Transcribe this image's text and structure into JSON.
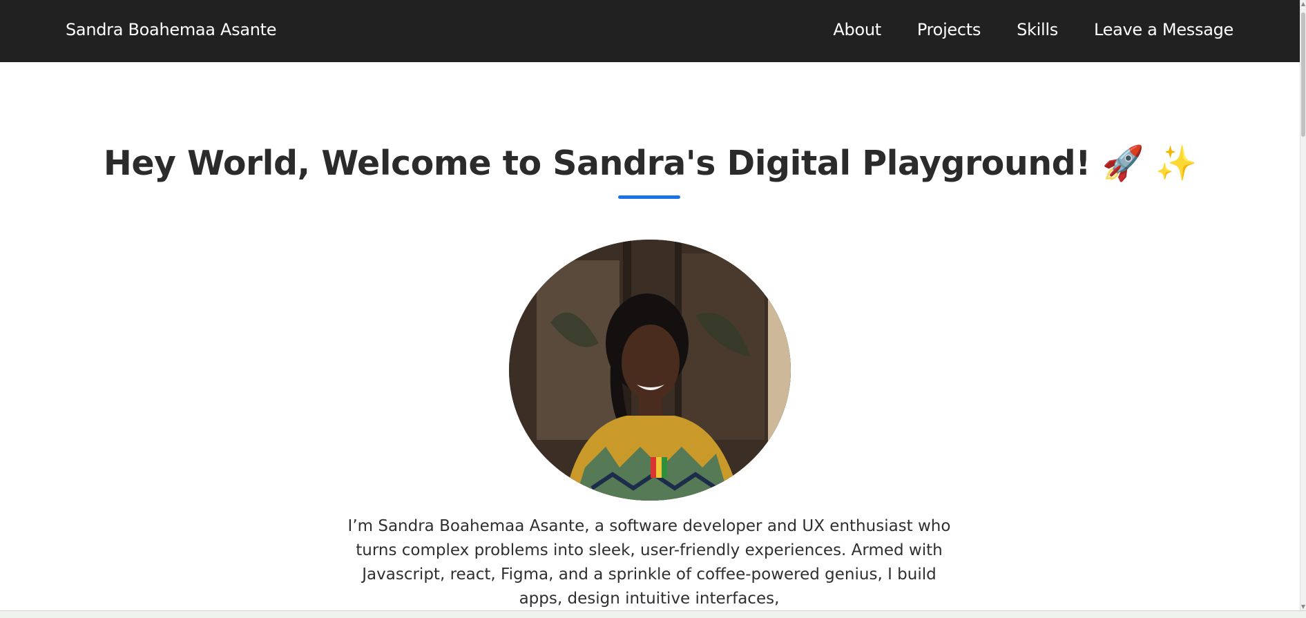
{
  "navbar": {
    "brand": "Sandra Boahemaa Asante",
    "links": [
      "About",
      "Projects",
      "Skills",
      "Leave a Message"
    ]
  },
  "hero": {
    "title": "Hey World, Welcome to Sandra's Digital Playground! 🚀 ✨",
    "accent_color": "#1a73e8",
    "avatar_icon": "profile-photo",
    "bio": "I’m Sandra Boahemaa Asante, a software developer and UX enthusiast who turns complex problems into sleek, user-friendly experiences. Armed with Javascript, react, Figma, and a sprinkle of coffee-powered genius, I build apps, design intuitive interfaces,"
  },
  "colors": {
    "navbar_bg": "#212121",
    "text_dark": "#2b2b2b"
  }
}
